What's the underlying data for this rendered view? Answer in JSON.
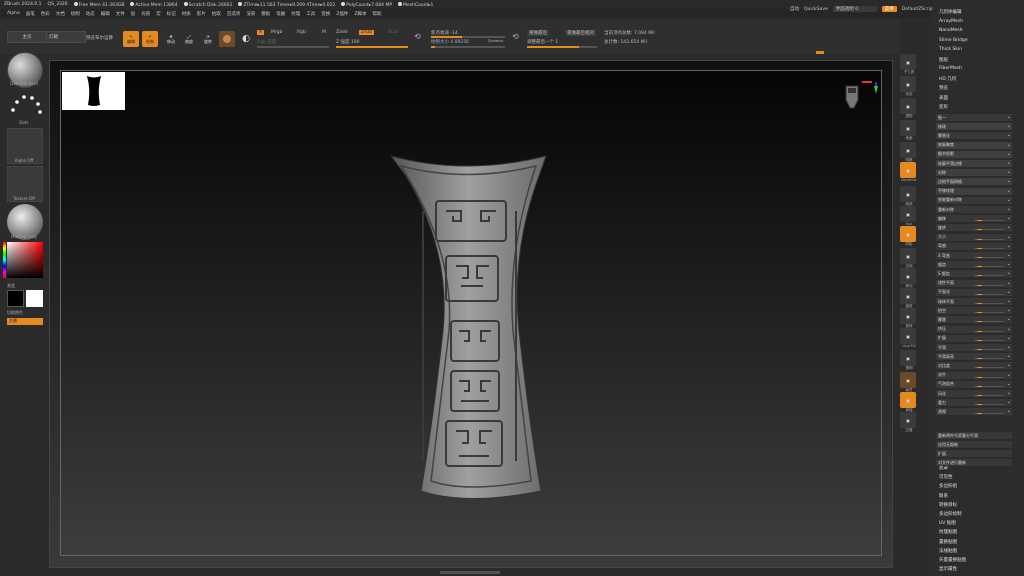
{
  "titlebar": {
    "app": "ZBrush 2024.0.1",
    "file": "QS_3326",
    "free_mem": "Free Mem 41.363GB",
    "active_mem": "Active Mem 13864",
    "scratch": "Scratch Disk 26661",
    "ztime": "ZTime▸11.563 Timer▸9.209 ATime▸0.022",
    "polycount": "PolyCount▸7.084 MP",
    "meshcount": "MeshCount▸1"
  },
  "menus": [
    "Alpha",
    "画笔",
    "色彩",
    "文档",
    "绘制",
    "动态",
    "编辑",
    "文件",
    "层",
    "光照",
    "宏",
    "标记",
    "材质",
    "影片",
    "拾取",
    "首选项",
    "渲染",
    "模板",
    "笔触",
    "纹理",
    "工具",
    "变换",
    "Z插件",
    "Z脚本",
    "帮助"
  ],
  "topright": {
    "autosave": "自动",
    "quicksave": "QuickSave",
    "transparency": "界面透明 0",
    "menus_btn": "菜单",
    "script": "DefaultZScript"
  },
  "shelf": {
    "btn_home": "主页",
    "btn_lightbox": "灯箱",
    "btn_preview": "预览布尔运算",
    "edit": "编辑",
    "draw": "绘制",
    "move": "移动",
    "scale": "缩放",
    "rotate": "旋转",
    "a_btn": "A",
    "mrgb": "Mrgb",
    "rgb": "Rgb",
    "m": "M",
    "zadd": "Zadd",
    "zsub": "Zsub",
    "zcut": "Zcut",
    "rgb_intensity": "Rgb 强度",
    "z_intensity": "Z 强度 100",
    "focal_shift": "焦点衰减 -14",
    "draw_size": "绘制大小 4.89256",
    "dynamic": "Dynamic",
    "active_points": "当前顶点总数: 7.084 Mil",
    "total_points": "总计数: 143.654 Mil",
    "redo_shading": "重做最后",
    "redo_rel": "重做最后相对",
    "adjust_last": "调整最后一个 1"
  },
  "left": {
    "brush": "DamStandard",
    "dots": "Dots",
    "alpha": "Alpha Off",
    "texture": "Texture Off",
    "material": "MatCap Gray",
    "gradient": "渐变",
    "switch_color": "切换颜色",
    "swap": "交替"
  },
  "rightcol": [
    "子工具",
    "动态",
    "透视",
    "地面",
    "网格",
    "Dynamic",
    "局部",
    "Xyz",
    "阴影",
    "空间",
    "移动",
    "缩放",
    "旋转",
    "Line Fill",
    "透明",
    "幽灵",
    "单独",
    "过渡"
  ],
  "menu_top": [
    "几何体编辑",
    "ArrayMesh",
    "NanoMesh",
    "Slime Bridge",
    "Thick Skin",
    "图层",
    "FiberMesh",
    "HD 几何",
    "预览",
    "表面",
    "变形"
  ],
  "deform": [
    "细一",
    "修改",
    "繁殖化",
    "修复聚焦",
    "细节投影",
    "轮廓平滑边缘",
    "对称",
    "边地平面网格",
    "平移纹理",
    "智能重新对称",
    "重新对称",
    "偏移",
    "旋转",
    "大小",
    "弯曲",
    "S 弯曲",
    "锯齿",
    "S 锯齿",
    "线性平面",
    "平面化",
    "球体平面",
    "拍空",
    "膨胀",
    "挤压",
    "扩展",
    "平滑",
    "平滑高亮",
    "对比度",
    "流平",
    "气泡组合",
    "风化",
    "重力",
    "透视"
  ],
  "deform_bottom": [
    "重新将符号浆客分平滑",
    "应用无限制",
    "扩展",
    "对文件进行重新"
  ],
  "menu_bottom": [
    "遮罩",
    "可见性",
    "多边形组",
    "联系",
    "转换目标",
    "多边形绘制",
    "UV 贴图",
    "纹理贴图",
    "置换贴图",
    "法线贴图",
    "矢量置换贴图",
    "显示属性"
  ],
  "colors": {
    "accent": "#e68a1f",
    "bg": "#2b2b2b"
  }
}
